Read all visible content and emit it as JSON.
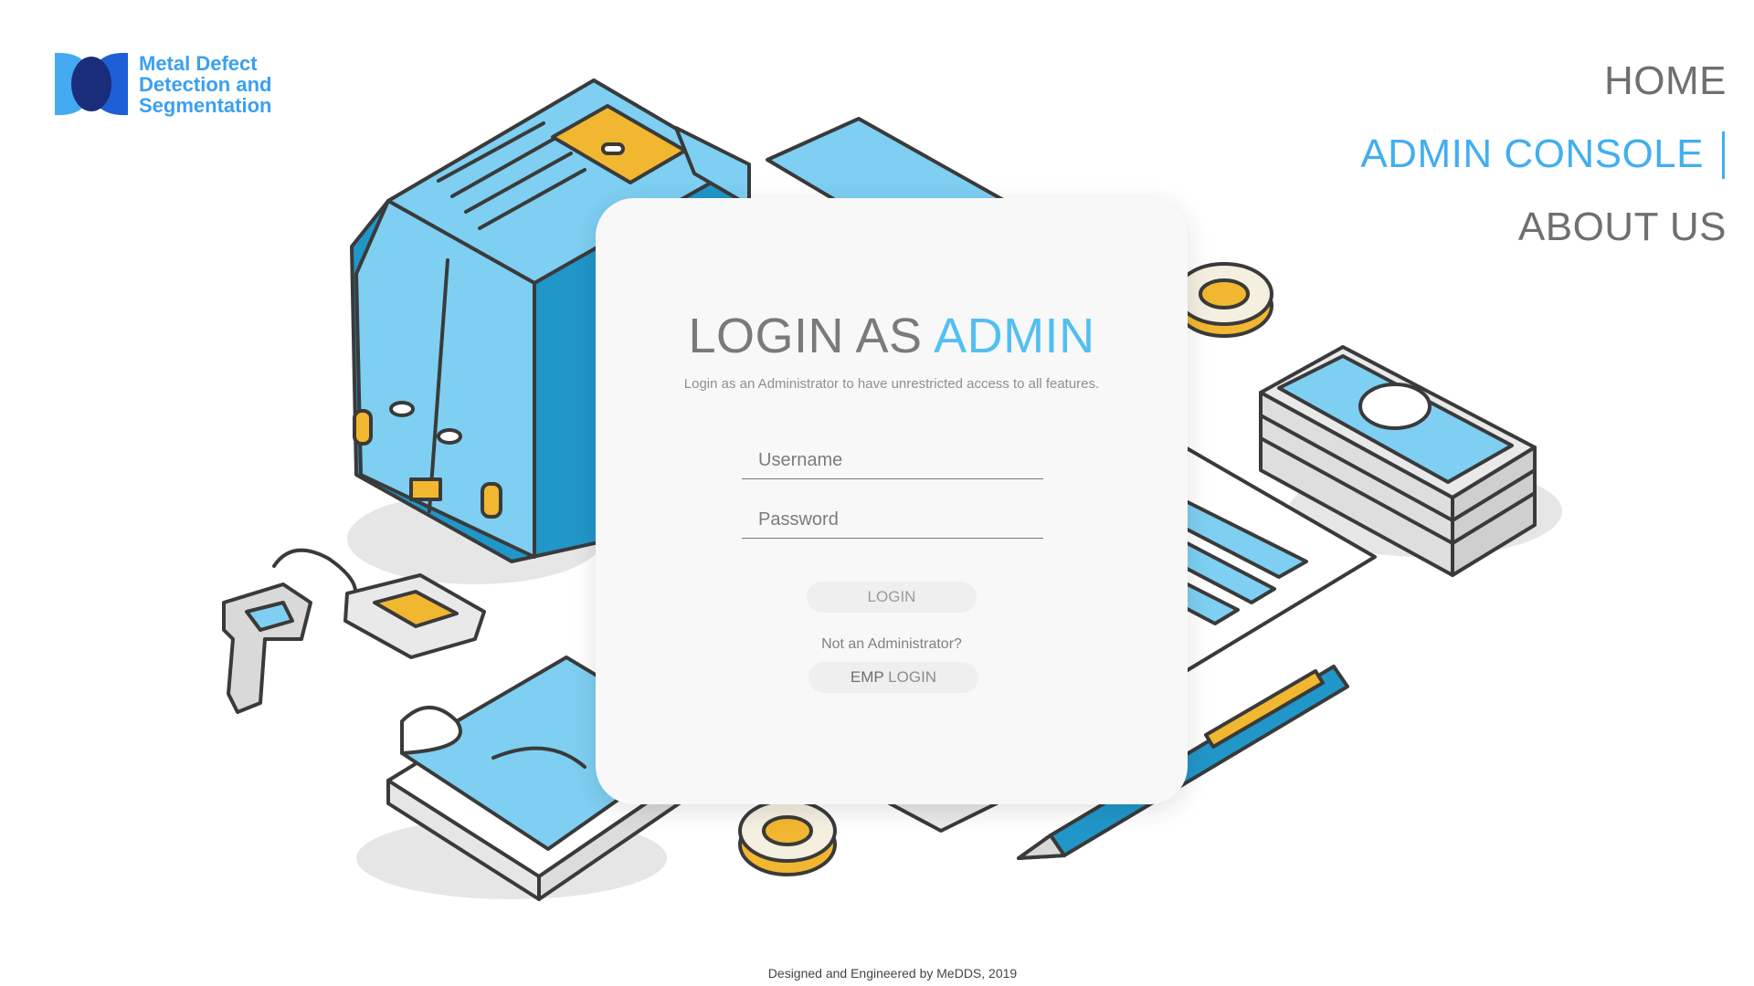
{
  "logo": {
    "line1": "Metal Defect",
    "line2": "Detection and",
    "line3": "Segmentation"
  },
  "nav": {
    "home": "HOME",
    "admin_console": "ADMIN CONSOLE",
    "about_us": "ABOUT US",
    "active": "ADMIN CONSOLE"
  },
  "login_card": {
    "title_prefix": "LOGIN AS ",
    "title_accent": "ADMIN",
    "subtitle": "Login as an Administrator to have unrestricted access to all features.",
    "username_placeholder": "Username",
    "password_placeholder": "Password",
    "login_button": "LOGIN",
    "not_admin_text": "Not an Administrator?",
    "emp_login_prefix": "EMP",
    "emp_login_suffix": " LOGIN"
  },
  "footer": {
    "text": "Designed and Engineered by MeDDS, 2019"
  },
  "colors": {
    "accent": "#42aef0",
    "nav_inactive": "#6f6f6f",
    "card_bg": "#f8f8f8",
    "illustration_blue": "#7ecff2",
    "illustration_dark_blue": "#2196c9",
    "illustration_yellow": "#f2b731",
    "outline": "#3a3a3a"
  }
}
